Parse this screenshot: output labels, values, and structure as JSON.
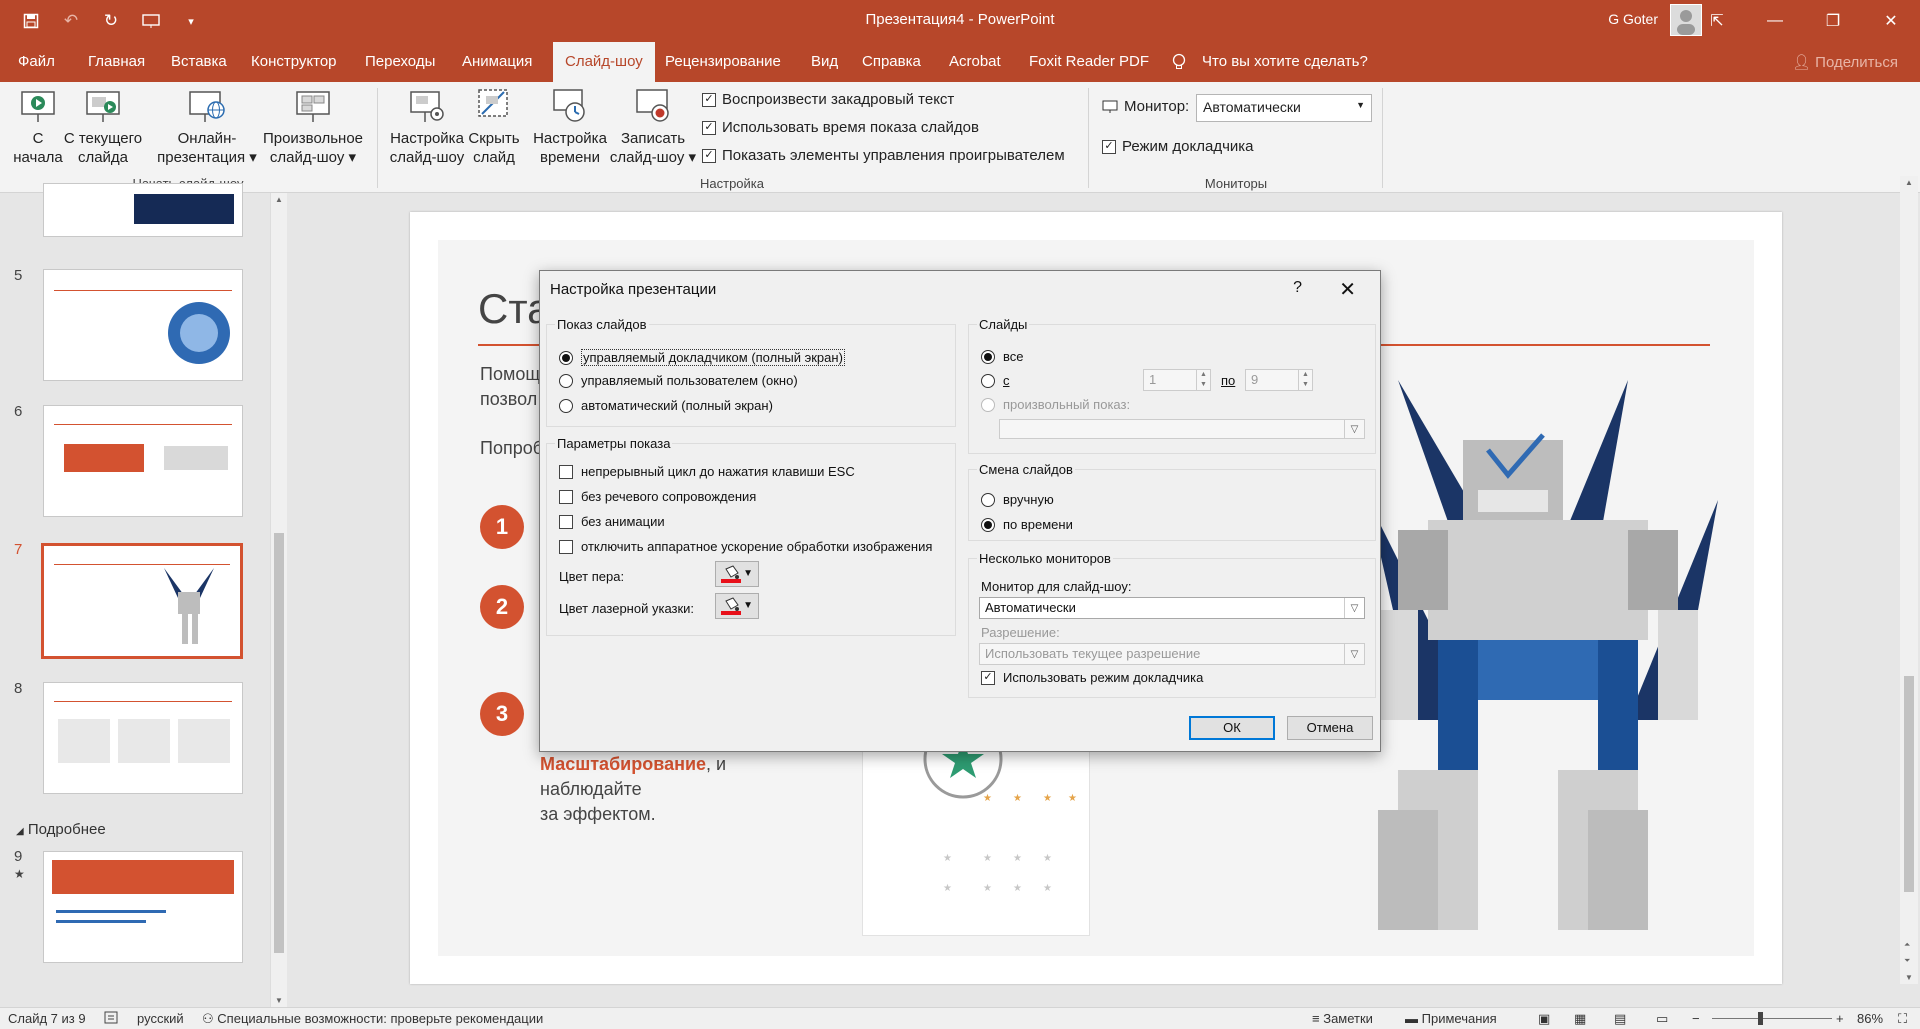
{
  "window": {
    "title": "Презентация4 - PowerPoint",
    "user": "G Goter"
  },
  "tabs": [
    {
      "label": "Файл"
    },
    {
      "label": "Главная"
    },
    {
      "label": "Вставка"
    },
    {
      "label": "Конструктор"
    },
    {
      "label": "Переходы"
    },
    {
      "label": "Анимация"
    },
    {
      "label": "Слайд-шоу"
    },
    {
      "label": "Рецензирование"
    },
    {
      "label": "Вид"
    },
    {
      "label": "Справка"
    },
    {
      "label": "Acrobat"
    },
    {
      "label": "Foxit Reader PDF"
    }
  ],
  "tell_me": "Что вы хотите сделать?",
  "share": "Поделиться",
  "ribbon": {
    "group_start": {
      "label": "Начать слайд-шоу",
      "from_start": "С\nначала",
      "from_current": "С текущего\nслайда",
      "online": "Онлайн-\nпрезентация ▾",
      "custom": "Произвольное\nслайд-шоу ▾"
    },
    "group_setup": {
      "label": "Настройка",
      "setup": "Настройка\nслайд-шоу",
      "hide": "Скрыть\nслайд",
      "rehearse": "Настройка\nвремени",
      "record": "Записать\nслайд-шоу ▾",
      "chk_narration": "Воспроизвести закадровый текст",
      "chk_timings": "Использовать время показа слайдов",
      "chk_controls": "Показать элементы управления проигрывателем"
    },
    "group_monitors": {
      "label": "Мониторы",
      "monitor_label": "Монитор:",
      "monitor_value": "Автоматически",
      "presenter_view": "Режим докладчика"
    }
  },
  "thumbnails": {
    "numbers": [
      "5",
      "6",
      "7",
      "8",
      "9"
    ],
    "selected": "7",
    "section": "Подробнее",
    "star": "★"
  },
  "slide": {
    "title": "Ста",
    "line1": "Помощ",
    "line2": "позвол",
    "line3": "Попроб",
    "steps": [
      "1",
      "2",
      "3"
    ],
    "highlight": "Масштабирование",
    "tail1": ", и",
    "tail2": "наблюдайте",
    "tail3": "за эффектом."
  },
  "dialog": {
    "title": "Настройка презентации",
    "help": "?",
    "show_type": {
      "legend": "Показ слайдов",
      "options": [
        "управляемый докладчиком (полный экран)",
        "управляемый пользователем (окно)",
        "автоматический (полный экран)"
      ]
    },
    "show_options": {
      "legend": "Параметры показа",
      "checks": [
        "непрерывный цикл до нажатия клавиши ESC",
        "без речевого сопровождения",
        "без анимации",
        "отключить аппаратное ускорение обработки изображения"
      ],
      "pen_color": "Цвет пера:",
      "laser_color": "Цвет лазерной указки:"
    },
    "slides": {
      "legend": "Слайды",
      "all": "все",
      "from": "с",
      "from_value": "1",
      "to": "по",
      "to_value": "9",
      "custom": "произвольный показ:"
    },
    "advance": {
      "legend": "Смена слайдов",
      "manual": "вручную",
      "timings": "по времени"
    },
    "monitors": {
      "legend": "Несколько мониторов",
      "monitor_label": "Монитор для слайд-шоу:",
      "monitor_value": "Автоматически",
      "resolution_label": "Разрешение:",
      "resolution_value": "Использовать текущее разрешение",
      "presenter_view": "Использовать режим докладчика"
    },
    "ok": "ОК",
    "cancel": "Отмена"
  },
  "statusbar": {
    "slide_info": "Слайд 7 из 9",
    "language": "русский",
    "accessibility": "Специальные возможности: проверьте рекомендации",
    "notes": "Заметки",
    "comments": "Примечания",
    "zoom": "86%"
  },
  "colors": {
    "accent": "#b7472a",
    "slide_accent": "#d35230",
    "pen": "#e8101a"
  }
}
